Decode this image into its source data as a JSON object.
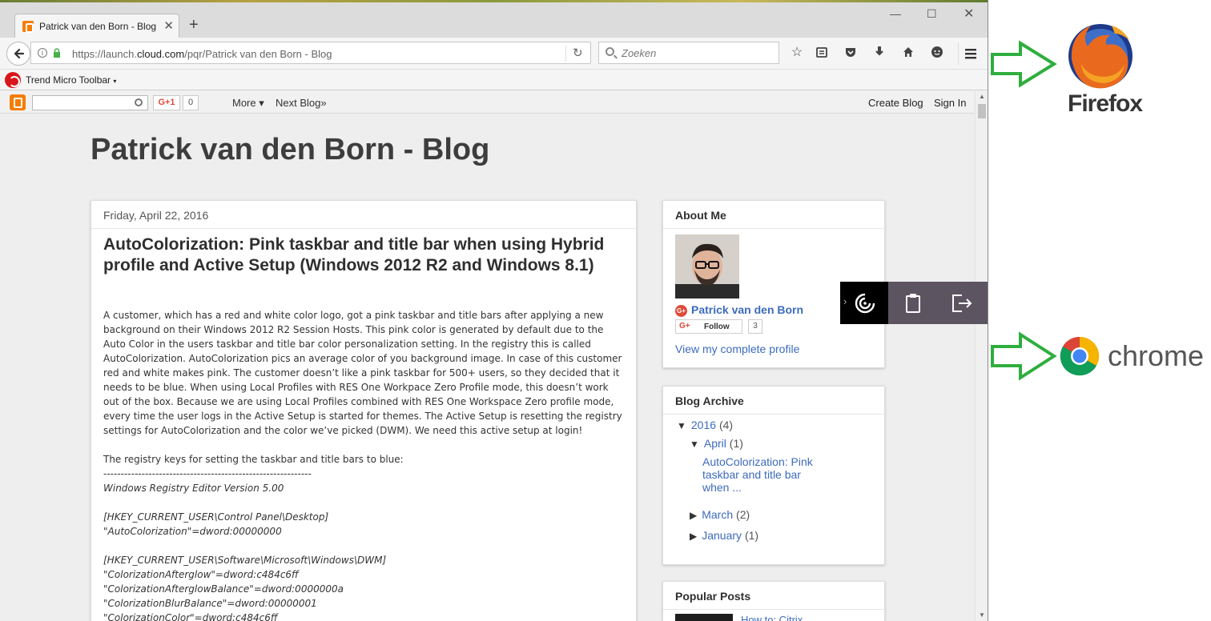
{
  "browser": {
    "tab_title": "Patrick van den Born - Blog",
    "new_tab": "+",
    "url_prefix": "https://launch.",
    "url_domain": "cloud.com",
    "url_suffix": "/pqr/Patrick van den Born - Blog",
    "search_placeholder": "Zoeken",
    "toolbar_label": "Trend Micro Toolbar",
    "icons": [
      "back-icon",
      "info-icon",
      "lock-icon",
      "reload-icon",
      "bookmark-star-icon",
      "reading-list-icon",
      "pocket-icon",
      "download-icon",
      "home-icon",
      "chat-icon",
      "menu-icon"
    ]
  },
  "bloggerbar": {
    "gplus": "G+1",
    "gplus_count": "0",
    "more": "More ▾",
    "next_blog": "Next Blog»",
    "create_blog": "Create Blog",
    "sign_in": "Sign In"
  },
  "blog": {
    "title": "Patrick van den Born - Blog",
    "post": {
      "date": "Friday, April 22, 2016",
      "title": "AutoColorization: Pink taskbar and title bar when using Hybrid profile and Active Setup (Windows 2012 R2 and Windows 8.1)",
      "paragraph": "A customer, which has a red and white color logo, got a pink taskbar and title bars after applying a new background on their Windows 2012 R2 Session Hosts. This pink color is generated by default due to the Auto Color in the users taskbar and title bar color personalization setting. In the registry this is called AutoColorization. AutoColorization pics an average color of you background image. In case of this customer red and white makes pink. The customer doesn’t like a pink taskbar for 500+ users, so they decided that it needs to be blue. When using Local Profiles with RES One Workpace Zero Profile mode, this doesn’t work out of the box. Because we are using Local Profiles combined with RES One Workspace Zero profile mode, every time the user logs in the Active Setup is started for themes. The Active Setup is resetting the registry settings for AutoColorization and the color we’ve picked (DWM). We need this active setup at login!",
      "registry_intro": "The registry keys for setting the taskbar and title bars to blue:",
      "separator": "------------------------------------------------------------",
      "reg_header": "Windows Registry Editor Version 5.00",
      "reg_key1": "[HKEY_CURRENT_USER\\Control Panel\\Desktop]",
      "reg_val1": "\"AutoColorization\"=dword:00000000",
      "reg_key2": "[HKEY_CURRENT_USER\\Software\\Microsoft\\Windows\\DWM]",
      "reg_val2": "\"ColorizationAfterglow\"=dword:c484c6ff",
      "reg_val3": "\"ColorizationAfterglowBalance\"=dword:0000000a",
      "reg_val4": "\"ColorizationBlurBalance\"=dword:00000001",
      "reg_val5": "\"ColorizationColor\"=dword:c484c6ff"
    },
    "about": {
      "title": "About Me",
      "name": "Patrick van den Born",
      "follow": "Follow",
      "follow_count": "3",
      "profile_link": "View my complete profile"
    },
    "archive": {
      "title": "Blog Archive",
      "year": "2016",
      "year_count": "(4)",
      "months": [
        {
          "name": "April",
          "count": "(1)",
          "expanded": true
        },
        {
          "name": "March",
          "count": "(2)",
          "expanded": false
        },
        {
          "name": "January",
          "count": "(1)",
          "expanded": false
        }
      ],
      "post_link": "AutoColorization: Pink taskbar and title bar when ..."
    },
    "popular": {
      "title": "Popular Posts",
      "first_item": "How to: Citrix"
    }
  },
  "annotations": {
    "firefox_label": "Firefox",
    "chrome_label": "chrome",
    "arrow_color": "#2fae3e"
  }
}
